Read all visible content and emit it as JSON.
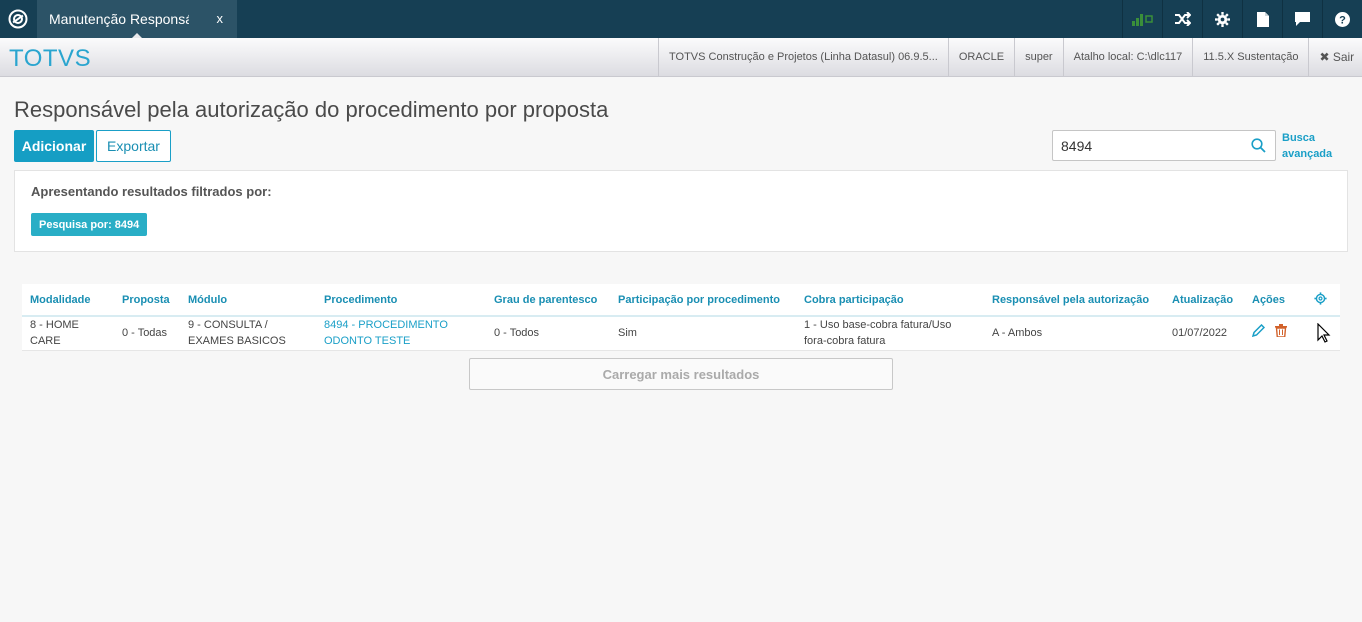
{
  "topbar": {
    "tab_label": "Manutenção Responsável",
    "tab_close": "x",
    "icons": [
      "signal-icon",
      "shuffle-icon",
      "gear-icon",
      "document-icon",
      "chat-icon",
      "help-icon"
    ]
  },
  "brandbar": {
    "brand": "TOTVS",
    "product": "TOTVS Construção e Projetos (Linha Datasul) 06.9.5...",
    "db": "ORACLE",
    "user": "super",
    "shortcut": "Atalho local: C:\\dlc117",
    "version": "11.5.X Sustentação",
    "exit": "✖ Sair"
  },
  "page": {
    "title": "Responsável pela autorização do procedimento por proposta",
    "add_label": "Adicionar",
    "export_label": "Exportar",
    "search_value": "8494",
    "advanced_search": "Busca avançada"
  },
  "filters": {
    "title": "Apresentando resultados filtrados por:",
    "chip": "Pesquisa por: 8494"
  },
  "table": {
    "headers": [
      "Modalidade",
      "Proposta",
      "Módulo",
      "Procedimento",
      "Grau de parentesco",
      "Participação por procedimento",
      "Cobra participação",
      "Responsável pela autorização",
      "Atualização",
      "Ações"
    ],
    "rows": [
      {
        "modalidade": "8 - HOME CARE",
        "proposta": "0 - Todas",
        "modulo": "9 - CONSULTA / EXAMES BASICOS",
        "procedimento": "8494 - PROCEDIMENTO ODONTO TESTE",
        "grau": "0 - Todos",
        "participacao": "Sim",
        "cobra": "1 - Uso base-cobra fatura/Uso fora-cobra fatura",
        "responsavel": "A - Ambos",
        "atualizacao": "01/07/2022"
      }
    ]
  },
  "load_more": "Carregar mais resultados",
  "colors": {
    "topbar": "#163f54",
    "accent": "#1a9fc7",
    "chip": "#29aec6",
    "delete": "#d2622b"
  }
}
